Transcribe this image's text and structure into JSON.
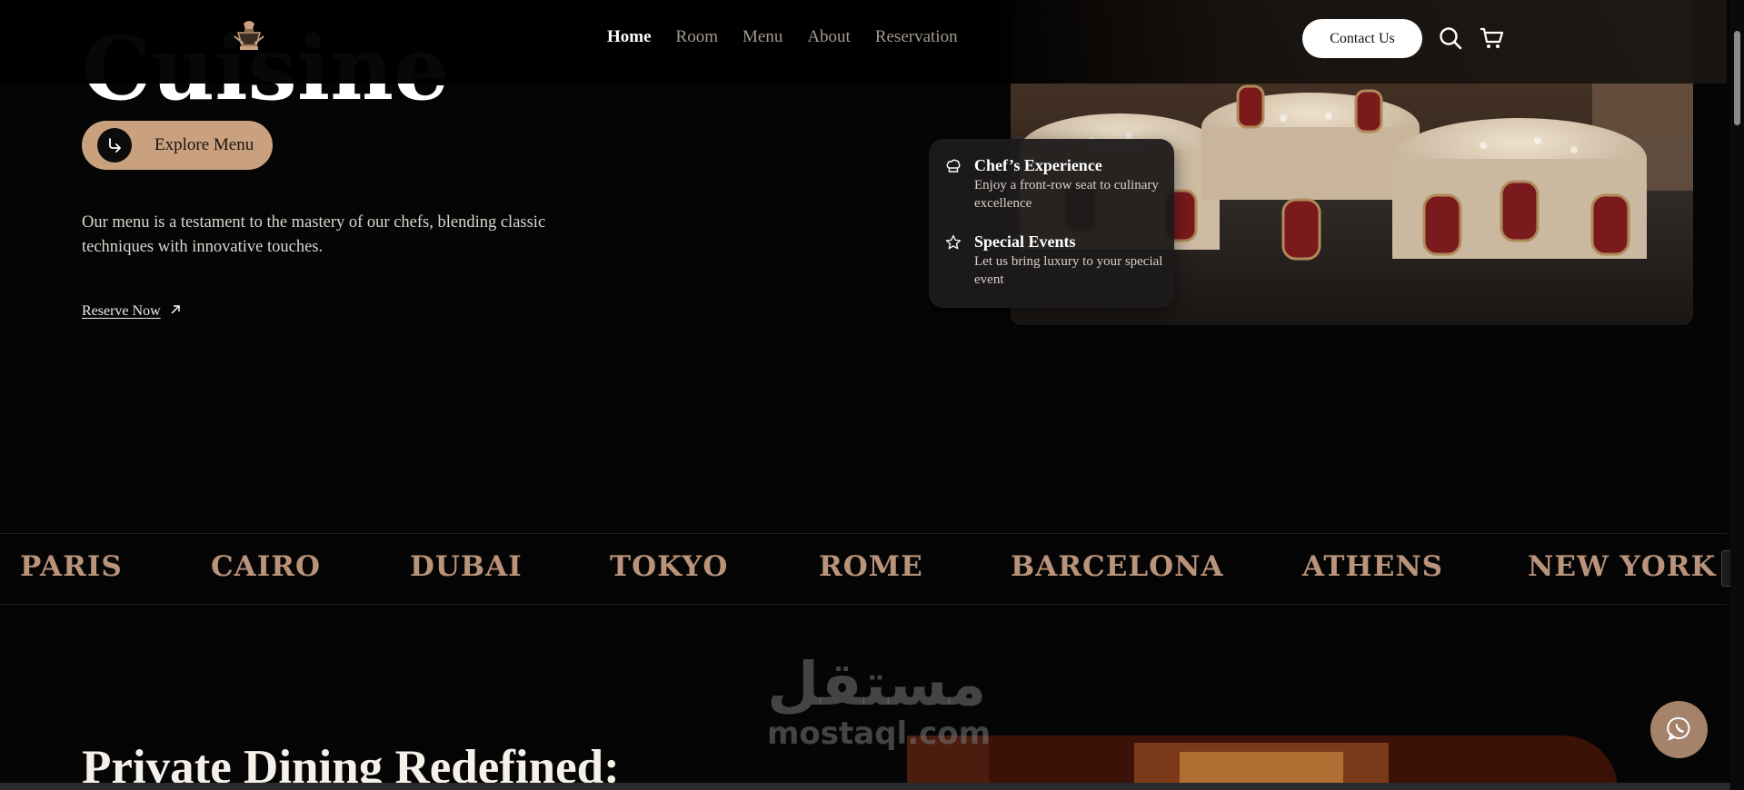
{
  "header": {
    "logo_icon": "crest-logo-icon",
    "nav": [
      {
        "label": "Home",
        "active": true
      },
      {
        "label": "Room",
        "active": false
      },
      {
        "label": "Menu",
        "active": false
      },
      {
        "label": "About",
        "active": false
      },
      {
        "label": "Reservation",
        "active": false
      }
    ],
    "contact_label": "Contact Us",
    "search_icon": "search-icon",
    "cart_icon": "cart-icon"
  },
  "hero": {
    "title_partial": "Cuisine",
    "explore_label": "Explore Menu",
    "description": "Our menu is a testament to the mastery of our chefs, blending classic techniques with innovative touches.",
    "reserve_label": "Reserve Now",
    "image_subject": "restaurant-dining-room-photo"
  },
  "features": [
    {
      "icon": "chef-hat-icon",
      "title": "Chef’s Experience",
      "text": "Enjoy a front-row seat to culinary excellence"
    },
    {
      "icon": "star-icon",
      "title": "Special Events",
      "text": "Let us bring luxury to your special event"
    }
  ],
  "marquee": {
    "cities": [
      "PARIS",
      "CAIRO",
      "DUBAI",
      "TOKYO",
      "ROME",
      "BARCELONA",
      "ATHENS",
      "NEW YORK"
    ]
  },
  "dining": {
    "title": "Private Dining Redefined:"
  },
  "watermark": {
    "arabic": "مستقل",
    "latin": "mostaql.com"
  },
  "chat": {
    "icon": "whatsapp-icon"
  },
  "colors": {
    "accent": "#c9a17e",
    "marquee_text": "#b9937a",
    "chat_button": "#a5836a",
    "background": "#050505"
  }
}
